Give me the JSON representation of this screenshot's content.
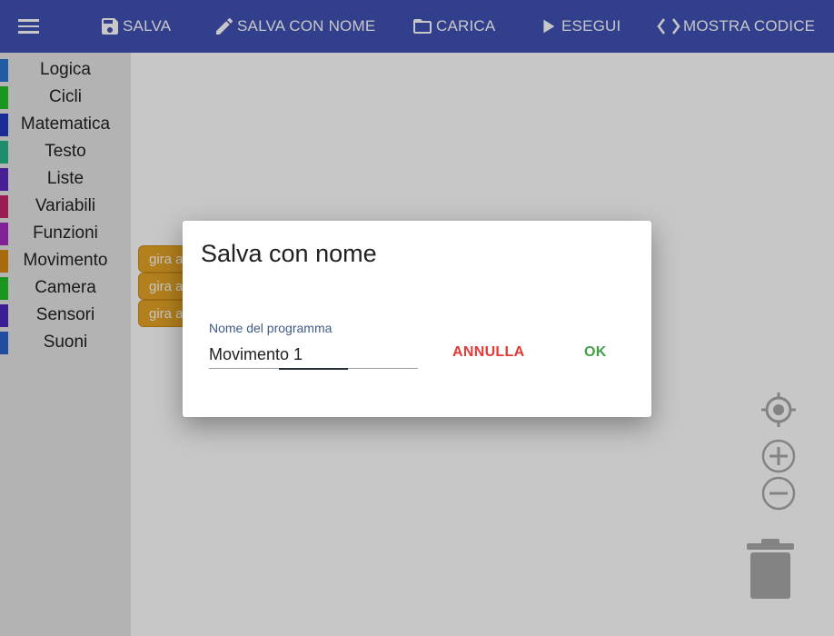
{
  "toolbar": {
    "save": "SALVA",
    "save_as": "SALVA CON NOME",
    "load": "CARICA",
    "run": "ESEGUI",
    "show_code": "MOSTRA CODICE"
  },
  "sidebar": {
    "categories": [
      {
        "label": "Logica",
        "color": "#2a75d2"
      },
      {
        "label": "Cicli",
        "color": "#21c12a"
      },
      {
        "label": "Matematica",
        "color": "#2436c1"
      },
      {
        "label": "Testo",
        "color": "#27b58b"
      },
      {
        "label": "Liste",
        "color": "#5a27c1"
      },
      {
        "label": "Variabili",
        "color": "#c4256b"
      },
      {
        "label": "Funzioni",
        "color": "#a52bc2"
      },
      {
        "label": "Movimento",
        "color": "#d88a10"
      },
      {
        "label": "Camera",
        "color": "#21c12a"
      },
      {
        "label": "Sensori",
        "color": "#4a27c1"
      },
      {
        "label": "Suoni",
        "color": "#2a63cc"
      }
    ]
  },
  "workspace": {
    "blocks": [
      "gira a",
      "gira a",
      "gira a"
    ]
  },
  "dialog": {
    "title": "Salva con nome",
    "field_label": "Nome del programma",
    "field_value": "Movimento 1",
    "cancel": "ANNULLA",
    "ok": "OK"
  },
  "colors": {
    "toolbar_bg": "#3f51b5",
    "cancel": "#e53935",
    "ok": "#43a047",
    "block": "#e6a526"
  },
  "icons": [
    "menu-icon",
    "save-icon",
    "pencil-icon",
    "folder-icon",
    "play-icon",
    "code-icon",
    "recenter-icon",
    "zoom-in-icon",
    "zoom-out-icon",
    "trash-icon"
  ]
}
